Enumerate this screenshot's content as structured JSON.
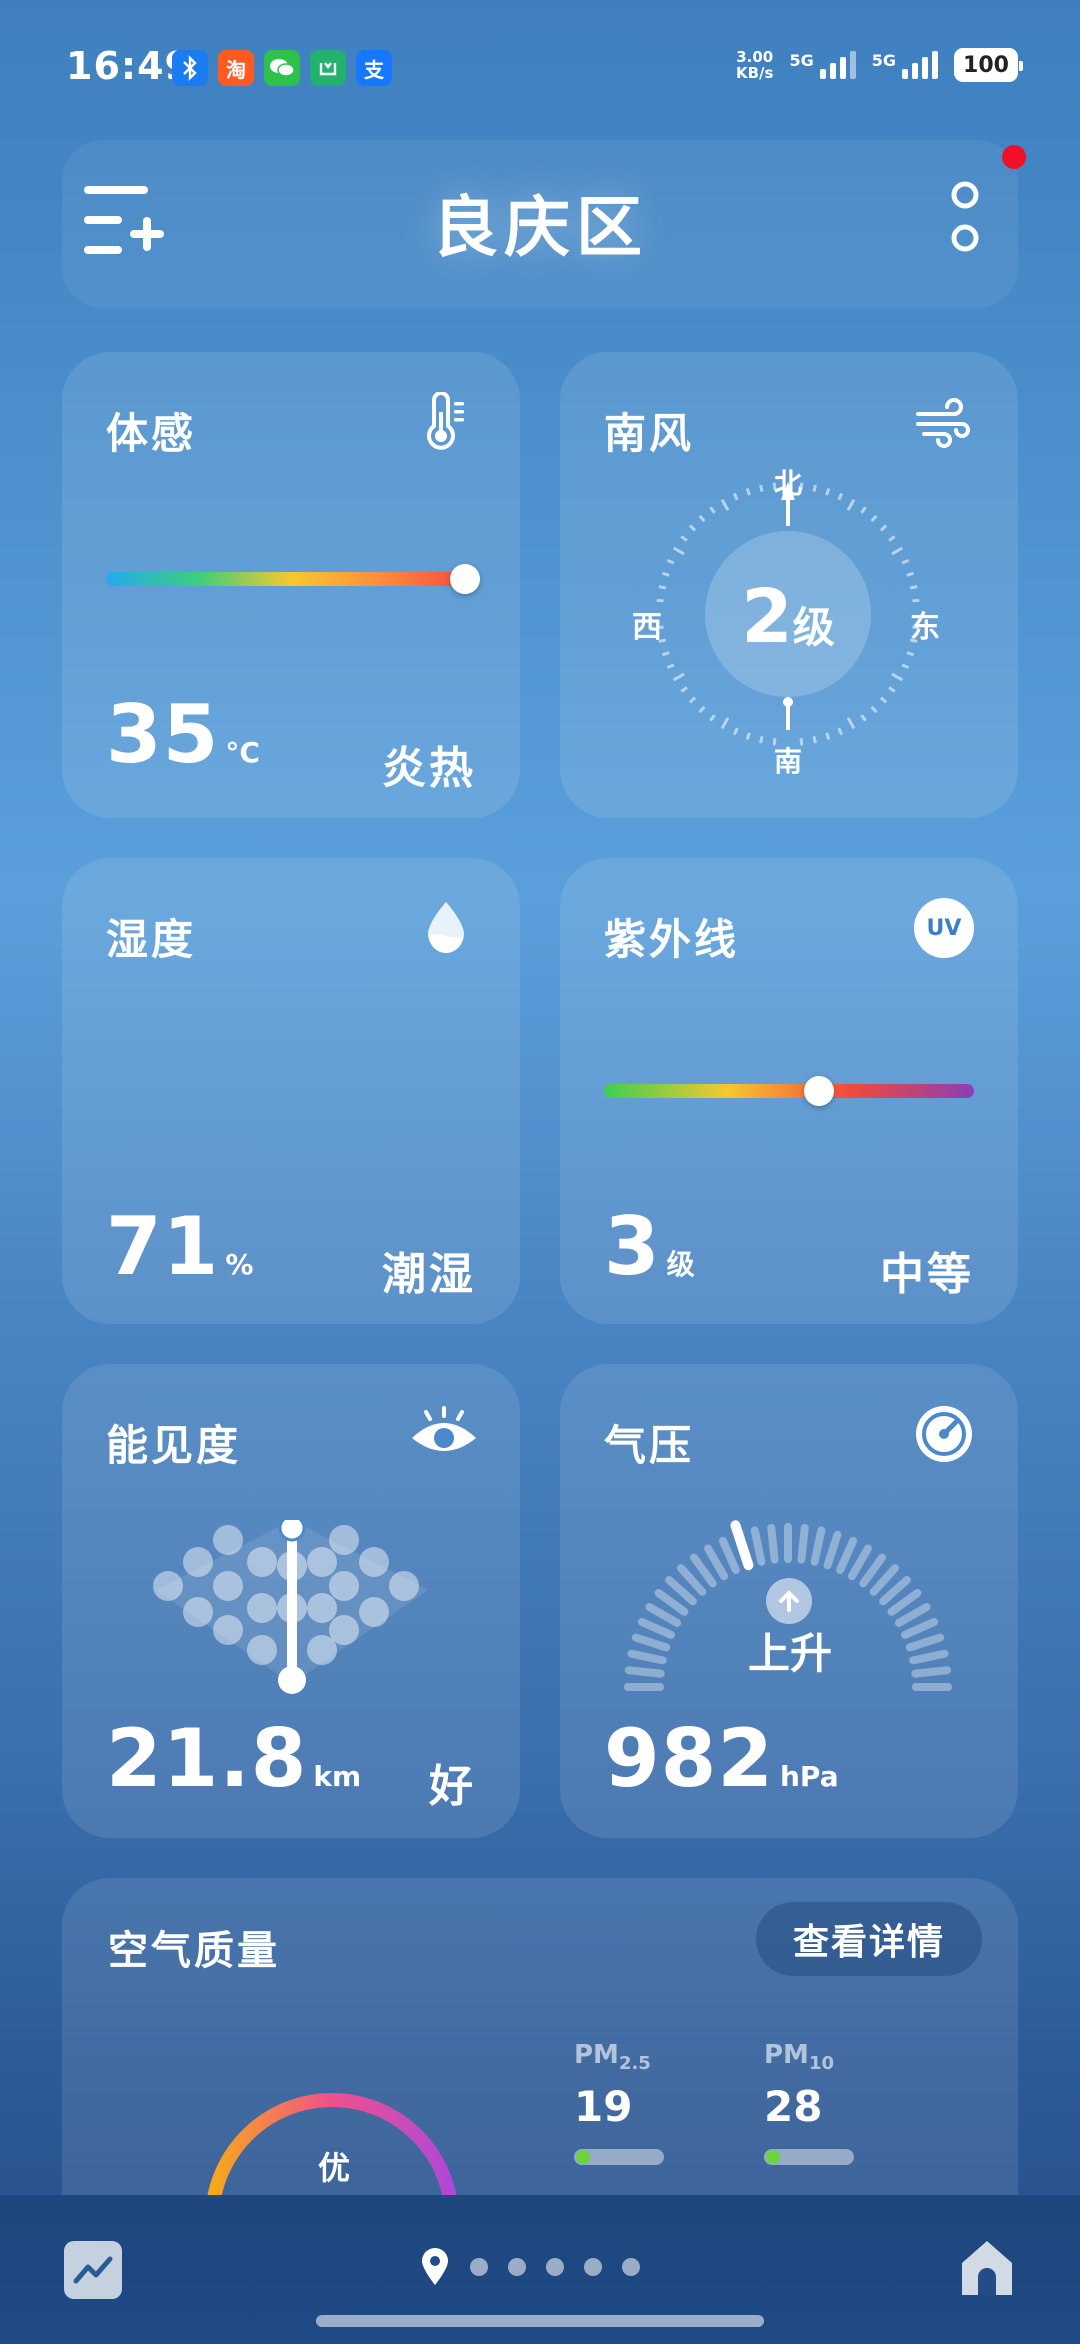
{
  "status_bar": {
    "time": "16:49",
    "apps": [
      {
        "name": "bluetooth-icon",
        "glyph": "ᛒ",
        "color": "#1a7cf0"
      },
      {
        "name": "taobao-icon",
        "glyph": "淘",
        "color": "#ff5a1f"
      },
      {
        "name": "wechat-icon",
        "glyph": "●",
        "color": "#2dc24c"
      },
      {
        "name": "mijia-icon",
        "glyph": "□",
        "color": "#23b26d"
      },
      {
        "name": "alipay-icon",
        "glyph": "支",
        "color": "#1677ff"
      }
    ],
    "net_speed_value": "3.00",
    "net_speed_unit": "KB/s",
    "signal1_label": "5G",
    "signal2_label": "5G",
    "battery": "100"
  },
  "header": {
    "city": "良庆区"
  },
  "cards": {
    "feels_like": {
      "title": "体感",
      "value": "35",
      "unit": "°C",
      "status": "炎热",
      "level": 0.97
    },
    "wind": {
      "title": "南风",
      "level_num": "2",
      "level_unit": "级",
      "north": "北",
      "south": "南",
      "west": "西",
      "east": "东"
    },
    "humidity": {
      "title": "湿度",
      "value": "71",
      "unit": "%",
      "status": "潮湿",
      "level": 0.71
    },
    "uv": {
      "title": "紫外线",
      "badge": "UV",
      "value": "3",
      "unit": "级",
      "status": "中等",
      "level": 0.58
    },
    "visibility": {
      "title": "能见度",
      "value": "21.8",
      "unit": "km",
      "status": "好"
    },
    "pressure": {
      "title": "气压",
      "trend": "上升",
      "value": "982",
      "unit": "hPa"
    }
  },
  "air_quality": {
    "title": "空气质量",
    "details_button": "查看详情",
    "level": "优",
    "pm25_label": "PM",
    "pm25_sub": "2.5",
    "pm25_value": "19",
    "pm10_label": "PM",
    "pm10_sub": "10",
    "pm10_value": "28"
  },
  "colors": {
    "temp_gradient": [
      "#25a9f0",
      "#3ccf7a",
      "#f5c830",
      "#ff8a3d",
      "#f2453d"
    ],
    "uv_gradient": [
      "#3bcf52",
      "#f5c830",
      "#f04a3a",
      "#8a3fb5"
    ],
    "notification": "#f0102a"
  }
}
